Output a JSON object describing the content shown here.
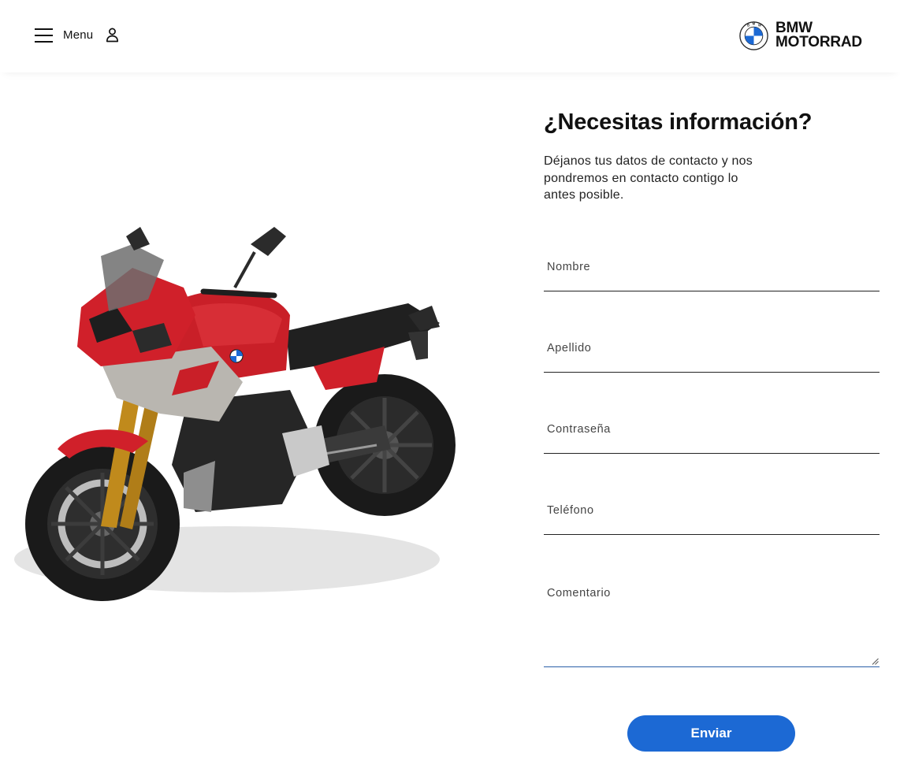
{
  "header": {
    "menu_label": "Menu",
    "logo_text": "BMW\nMOTORRAD",
    "menu_icon": "hamburger-icon",
    "user_icon": "user-icon"
  },
  "hero": {
    "image": "motorcycle-image",
    "colors": {
      "body_red": "#d0202a",
      "fairing_grey": "#b9b6b0"
    }
  },
  "form": {
    "title": "¿Necesitas información?",
    "subtitle": "Déjanos tus datos de contacto y nos pondremos en contacto contigo lo antes posible.",
    "fields": [
      {
        "placeholder": "Nombre",
        "value": ""
      },
      {
        "placeholder": "Apellido",
        "value": ""
      },
      {
        "placeholder": "Contraseña",
        "value": ""
      },
      {
        "placeholder": "Teléfono",
        "value": ""
      }
    ],
    "comment_placeholder": "Comentario",
    "submit_label": "Enviar"
  },
  "colors": {
    "accent": "#1c69d4",
    "text": "#111111",
    "background": "#ffffff"
  }
}
